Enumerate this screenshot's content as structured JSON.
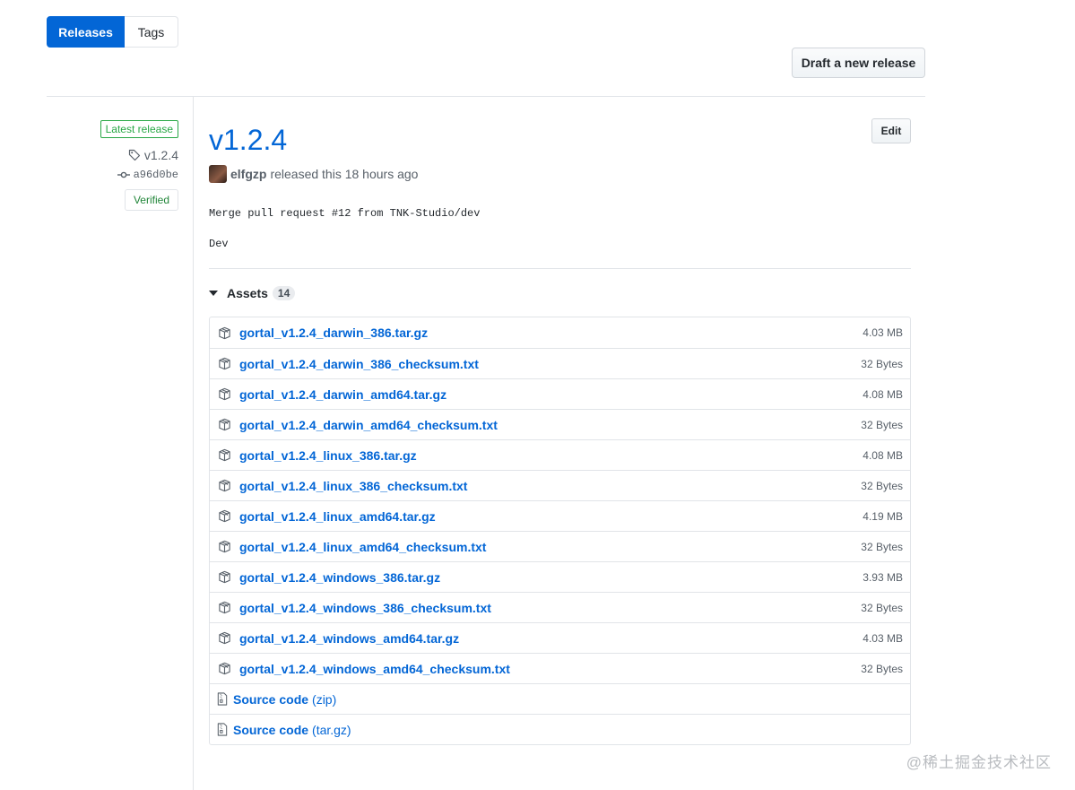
{
  "tabs": {
    "releases": "Releases",
    "tags": "Tags"
  },
  "actions": {
    "draft_new_release": "Draft a new release",
    "edit": "Edit"
  },
  "sidebar": {
    "latest_badge": "Latest release",
    "tag": "v1.2.4",
    "commit": "a96d0be",
    "verified": "Verified"
  },
  "release": {
    "title": "v1.2.4",
    "author": "elfgzp",
    "released_text": "released this 18 hours ago",
    "body": [
      "Merge pull request #12 from TNK-Studio/dev",
      "Dev"
    ]
  },
  "assets": {
    "label": "Assets",
    "count": "14",
    "files": [
      {
        "name": "gortal_v1.2.4_darwin_386.tar.gz",
        "size": "4.03 MB"
      },
      {
        "name": "gortal_v1.2.4_darwin_386_checksum.txt",
        "size": "32 Bytes"
      },
      {
        "name": "gortal_v1.2.4_darwin_amd64.tar.gz",
        "size": "4.08 MB"
      },
      {
        "name": "gortal_v1.2.4_darwin_amd64_checksum.txt",
        "size": "32 Bytes"
      },
      {
        "name": "gortal_v1.2.4_linux_386.tar.gz",
        "size": "4.08 MB"
      },
      {
        "name": "gortal_v1.2.4_linux_386_checksum.txt",
        "size": "32 Bytes"
      },
      {
        "name": "gortal_v1.2.4_linux_amd64.tar.gz",
        "size": "4.19 MB"
      },
      {
        "name": "gortal_v1.2.4_linux_amd64_checksum.txt",
        "size": "32 Bytes"
      },
      {
        "name": "gortal_v1.2.4_windows_386.tar.gz",
        "size": "3.93 MB"
      },
      {
        "name": "gortal_v1.2.4_windows_386_checksum.txt",
        "size": "32 Bytes"
      },
      {
        "name": "gortal_v1.2.4_windows_amd64.tar.gz",
        "size": "4.03 MB"
      },
      {
        "name": "gortal_v1.2.4_windows_amd64_checksum.txt",
        "size": "32 Bytes"
      }
    ],
    "source": [
      {
        "label": "Source code",
        "format": "(zip)"
      },
      {
        "label": "Source code",
        "format": "(tar.gz)"
      }
    ]
  },
  "watermark": "@稀土掘金技术社区",
  "colors": {
    "accent": "#0366d6",
    "success": "#28a745",
    "verified": "#22863a",
    "border": "#e1e4e8"
  }
}
